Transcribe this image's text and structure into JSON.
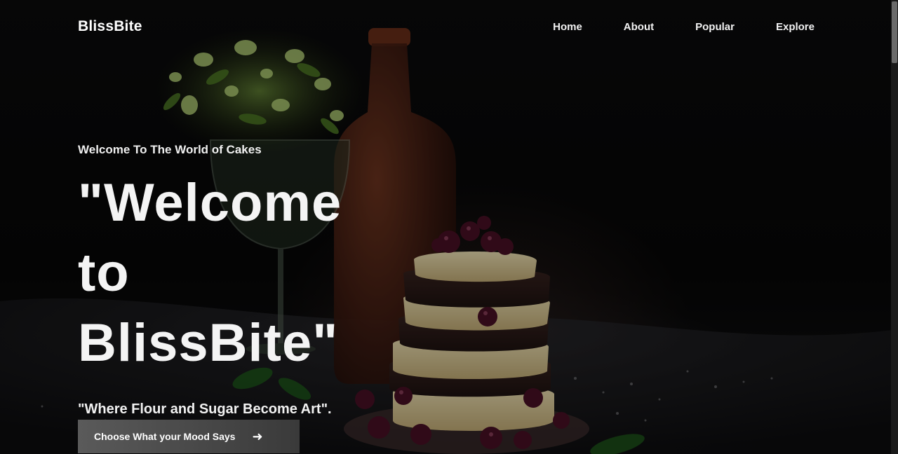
{
  "nav": {
    "brand": "BlissBite",
    "links": [
      "Home",
      "About",
      "Popular",
      "Explore"
    ]
  },
  "hero": {
    "subtitle": "Welcome To The World of Cakes",
    "headline_lines": [
      "\"Welcome",
      "to",
      "BlissBite\""
    ],
    "tagline": "\"Where Flour and Sugar Become Art\".",
    "cta_label": "Choose What your Mood Says",
    "cta_icon": "arrow-right-icon"
  },
  "colors": {
    "background": "#050505",
    "text": "#ffffff",
    "cta_background": "#4a4a4a"
  }
}
